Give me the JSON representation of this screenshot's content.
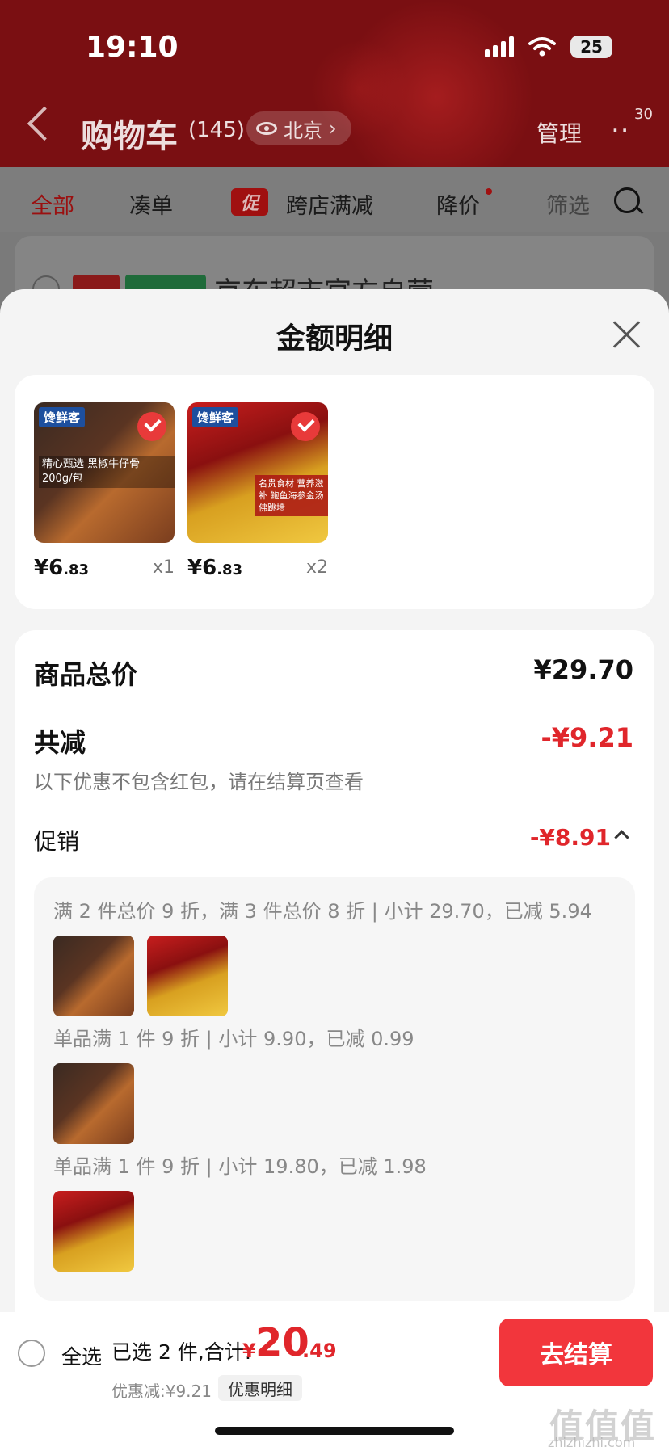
{
  "status_bar": {
    "time": "19:10",
    "battery": "25"
  },
  "header": {
    "title": "购物车",
    "count": "(145)",
    "location": "北京",
    "manage": "管理",
    "notification_count": "30"
  },
  "tabs": [
    {
      "label": "全部"
    },
    {
      "label": "凑单"
    },
    {
      "label": "跨店满减",
      "tag": "促"
    },
    {
      "label": "降价"
    },
    {
      "label": "筛选"
    }
  ],
  "background_store": {
    "name": "京东超市官方自营"
  },
  "sheet": {
    "title": "金额明细",
    "items": [
      {
        "brand": "馋鲜客",
        "caption": "精心甄选 黑椒牛仔骨 200g/包",
        "price_int": "¥6",
        "price_dec": ".83",
        "qty": "x1"
      },
      {
        "brand": "馋鲜客",
        "caption": "名贵食材 营养滋补 鲍鱼海参金汤佛跳墙",
        "price_int": "¥6",
        "price_dec": ".83",
        "qty": "x2"
      }
    ],
    "total_label": "商品总价",
    "total_value": "¥29.70",
    "reduce_label": "共减",
    "reduce_value": "-¥9.21",
    "note": "以下优惠不包含红包，请在结算页查看",
    "promo_label": "促销",
    "promo_value": "-¥8.91",
    "rules": [
      "满 2 件总价 9 折，满 3 件总价 8 折 | 小计 29.70，已减 5.94",
      "单品满 1 件 9 折 | 小计 9.90，已减 0.99",
      "单品满 1 件 9 折 | 小计 19.80，已减 1.98"
    ]
  },
  "bottom": {
    "select_all": "全选",
    "summary": "已选 2 件,合计:",
    "currency": "¥",
    "total_int": "20",
    "total_dec": ".49",
    "discount": "优惠减:¥9.21",
    "discount_detail": "优惠明细",
    "checkout": "去结算"
  },
  "watermark": {
    "text": "值值值",
    "url": "zhizhizhi.com"
  },
  "colors": {
    "accent_red": "#e0262b",
    "header_red": "#7a0f12",
    "checkout_red": "#f2363c"
  }
}
